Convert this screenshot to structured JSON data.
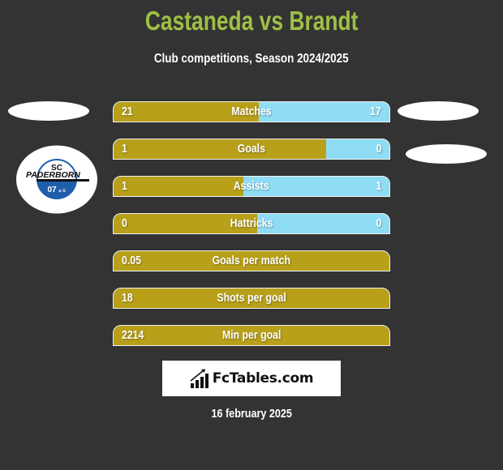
{
  "header": {
    "title": "Castaneda vs Brandt",
    "subtitle": "Club competitions, Season 2024/2025"
  },
  "colors": {
    "background": "#333333",
    "title": "#9ec045",
    "left_bar": "#b8a01a",
    "right_bar": "#8fdcf5"
  },
  "left_team": {
    "logo": {
      "top_text": "SC",
      "name_text": "PADERBORN",
      "bottom_text": "07",
      "bottom_suffix": "e.V."
    }
  },
  "stats": [
    {
      "label": "Matches",
      "left": "21",
      "right": "17",
      "left_share": 0.526
    },
    {
      "label": "Goals",
      "left": "1",
      "right": "0",
      "left_share": 0.77
    },
    {
      "label": "Assists",
      "left": "1",
      "right": "1",
      "left_share": 0.47
    },
    {
      "label": "Hattricks",
      "left": "0",
      "right": "0",
      "left_share": 0.52
    },
    {
      "label": "Goals per match",
      "left": "0.05",
      "right": "",
      "left_share": 1.0
    },
    {
      "label": "Shots per goal",
      "left": "18",
      "right": "",
      "left_share": 1.0
    },
    {
      "label": "Min per goal",
      "left": "2214",
      "right": "",
      "left_share": 1.0
    }
  ],
  "branding": {
    "site": "FcTables.com",
    "icon": "bar-chart-arrow-icon"
  },
  "date": "16 february 2025"
}
